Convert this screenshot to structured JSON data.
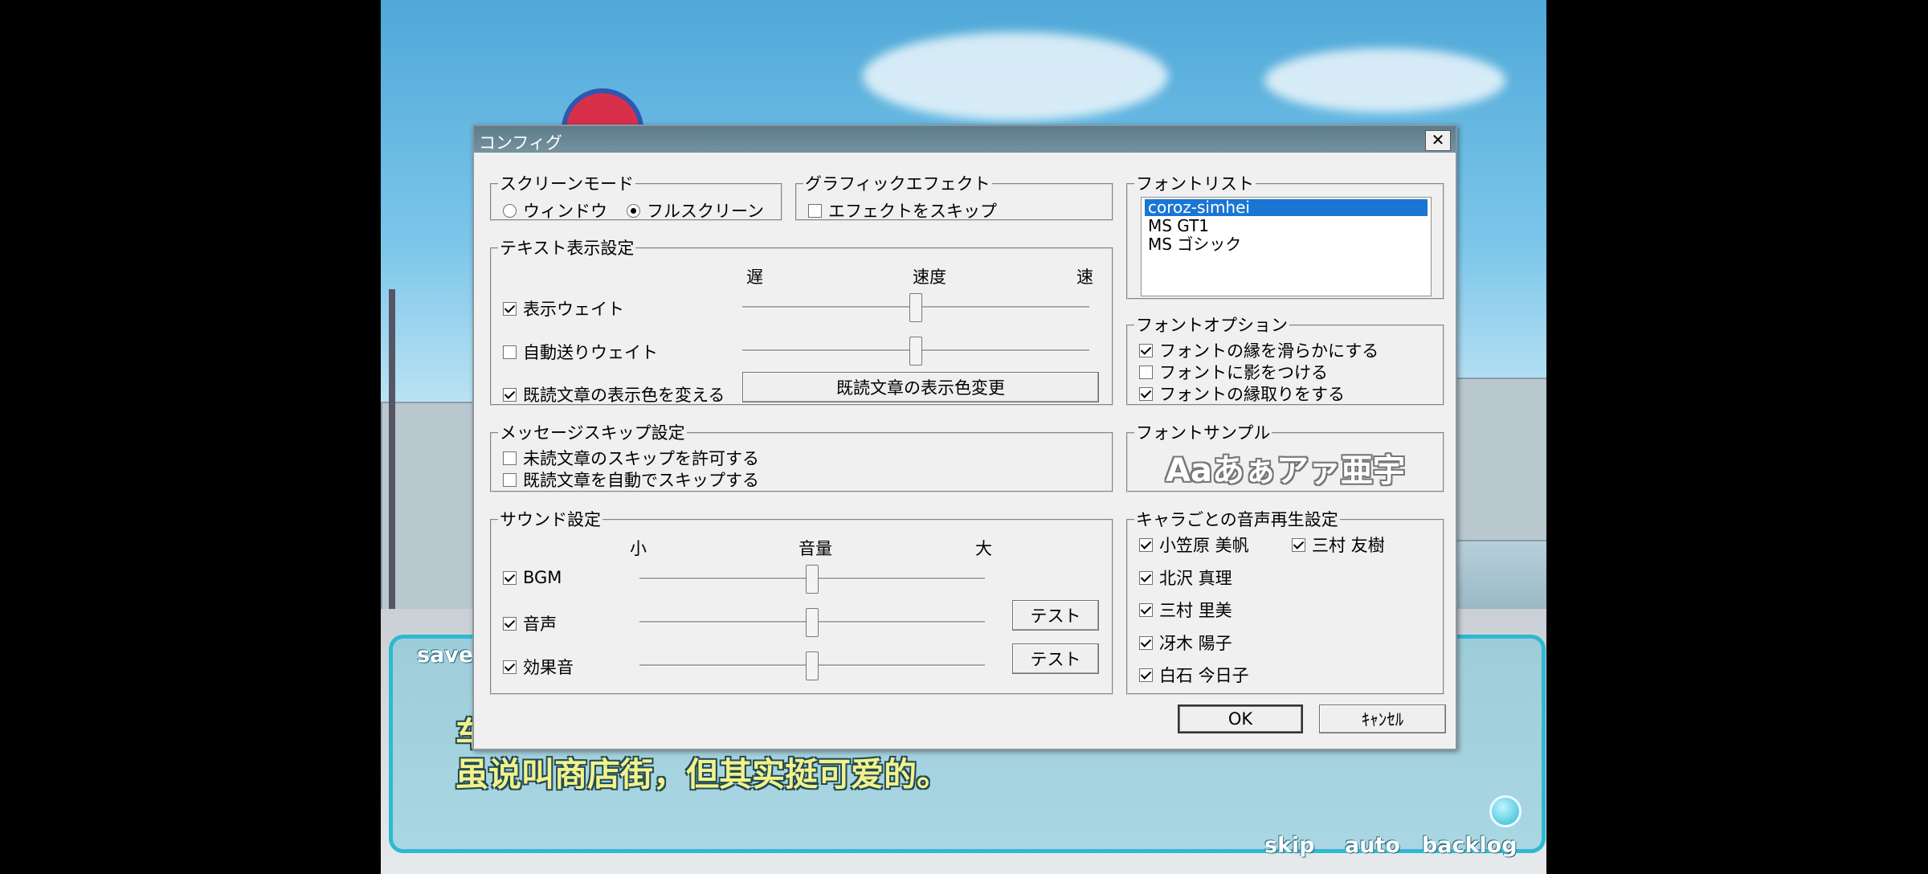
{
  "game": {
    "dialogue_line1": "车",
    "dialogue_line2": "虽说叫商店街，但其实挺可爱的。",
    "save_label": "save",
    "skip_label": "skip",
    "auto_label": "auto",
    "backlog_label": "backlog"
  },
  "dialog": {
    "title": "コンフィグ",
    "close_glyph": "✕",
    "screen_mode": {
      "legend": "スクリーンモード",
      "window_label": "ウィンドウ",
      "window_selected": false,
      "fullscreen_label": "フルスクリーン",
      "fullscreen_selected": true
    },
    "graphic_effect": {
      "legend": "グラフィックエフェクト",
      "skip_effect_label": "エフェクトをスキップ",
      "skip_effect_checked": false
    },
    "text_display": {
      "legend": "テキスト表示設定",
      "slow_label": "遅",
      "speed_label": "速度",
      "fast_label": "速",
      "display_wait_label": "表示ウェイト",
      "display_wait_checked": true,
      "display_wait_value": 0.5,
      "auto_wait_label": "自動送りウェイト",
      "auto_wait_checked": false,
      "auto_wait_value": 0.5,
      "read_color_label": "既読文章の表示色を変える",
      "read_color_checked": true,
      "read_color_button": "既読文章の表示色変更"
    },
    "message_skip": {
      "legend": "メッセージスキップ設定",
      "allow_unread_label": "未読文章のスキップを許可する",
      "allow_unread_checked": false,
      "auto_skip_read_label": "既読文章を自動でスキップする",
      "auto_skip_read_checked": false
    },
    "sound": {
      "legend": "サウンド設定",
      "small_label": "小",
      "volume_label": "音量",
      "large_label": "大",
      "bgm_label": "BGM",
      "bgm_checked": true,
      "bgm_value": 0.5,
      "voice_label": "音声",
      "voice_checked": true,
      "voice_value": 0.5,
      "se_label": "効果音",
      "se_checked": true,
      "se_value": 0.5,
      "test_label": "テスト"
    },
    "font_list": {
      "legend": "フォントリスト",
      "items": [
        "coroz-simhei",
        "MS GT1",
        "MS ゴシック"
      ],
      "selected_index": 0
    },
    "font_options": {
      "legend": "フォントオプション",
      "smooth_label": "フォントの縁を滑らかにする",
      "smooth_checked": true,
      "shadow_label": "フォントに影をつける",
      "shadow_checked": false,
      "outline_label": "フォントの縁取りをする",
      "outline_checked": true
    },
    "font_sample": {
      "legend": "フォントサンプル",
      "text": "Aaあぁアァ亜宇"
    },
    "character_voice": {
      "legend": "キャラごとの音声再生設定",
      "characters": [
        {
          "name": "小笠原 美帆",
          "checked": true
        },
        {
          "name": "三村 友樹",
          "checked": true
        },
        {
          "name": "北沢 真理",
          "checked": true
        },
        {
          "name": "三村 里美",
          "checked": true
        },
        {
          "name": "冴木 陽子",
          "checked": true
        },
        {
          "name": "白石 今日子",
          "checked": true
        }
      ]
    },
    "ok_label": "OK",
    "cancel_label": "ｷｬﾝｾﾙ"
  }
}
